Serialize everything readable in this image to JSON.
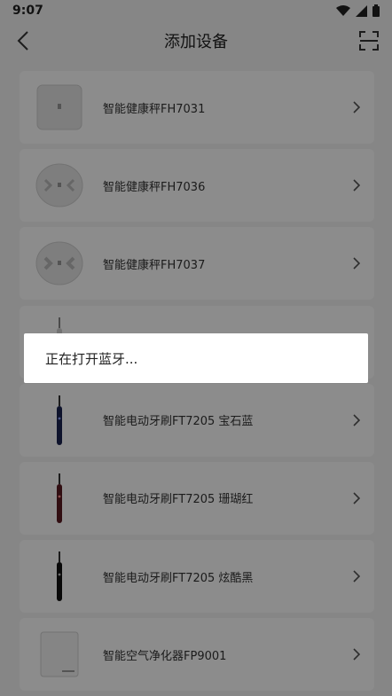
{
  "status_bar": {
    "time": "9:07",
    "icons": [
      "wifi-icon",
      "signal-icon",
      "battery-icon"
    ]
  },
  "header": {
    "title": "添加设备",
    "back_icon": "back-arrow-icon",
    "scan_icon": "scan-icon"
  },
  "devices": [
    {
      "label": "智能健康秤FH7031",
      "icon": "square-scale-icon"
    },
    {
      "label": "智能健康秤FH7036",
      "icon": "round-scale-icon"
    },
    {
      "label": "智能健康秤FH7037",
      "icon": "round-scale-icon"
    },
    {
      "label": "",
      "icon": "toothbrush-icon"
    },
    {
      "label": "智能电动牙刷FT7205 宝石蓝",
      "icon": "toothbrush-blue-icon"
    },
    {
      "label": "智能电动牙刷FT7205 珊瑚红",
      "icon": "toothbrush-red-icon"
    },
    {
      "label": "智能电动牙刷FT7205 炫酷黑",
      "icon": "toothbrush-black-icon"
    },
    {
      "label": "智能空气净化器FP9001",
      "icon": "air-purifier-icon"
    }
  ],
  "dialog": {
    "message": "正在打开蓝牙..."
  },
  "colors": {
    "overlay": "#000000",
    "background": "#f5f5f5",
    "card": "#ffffff"
  }
}
